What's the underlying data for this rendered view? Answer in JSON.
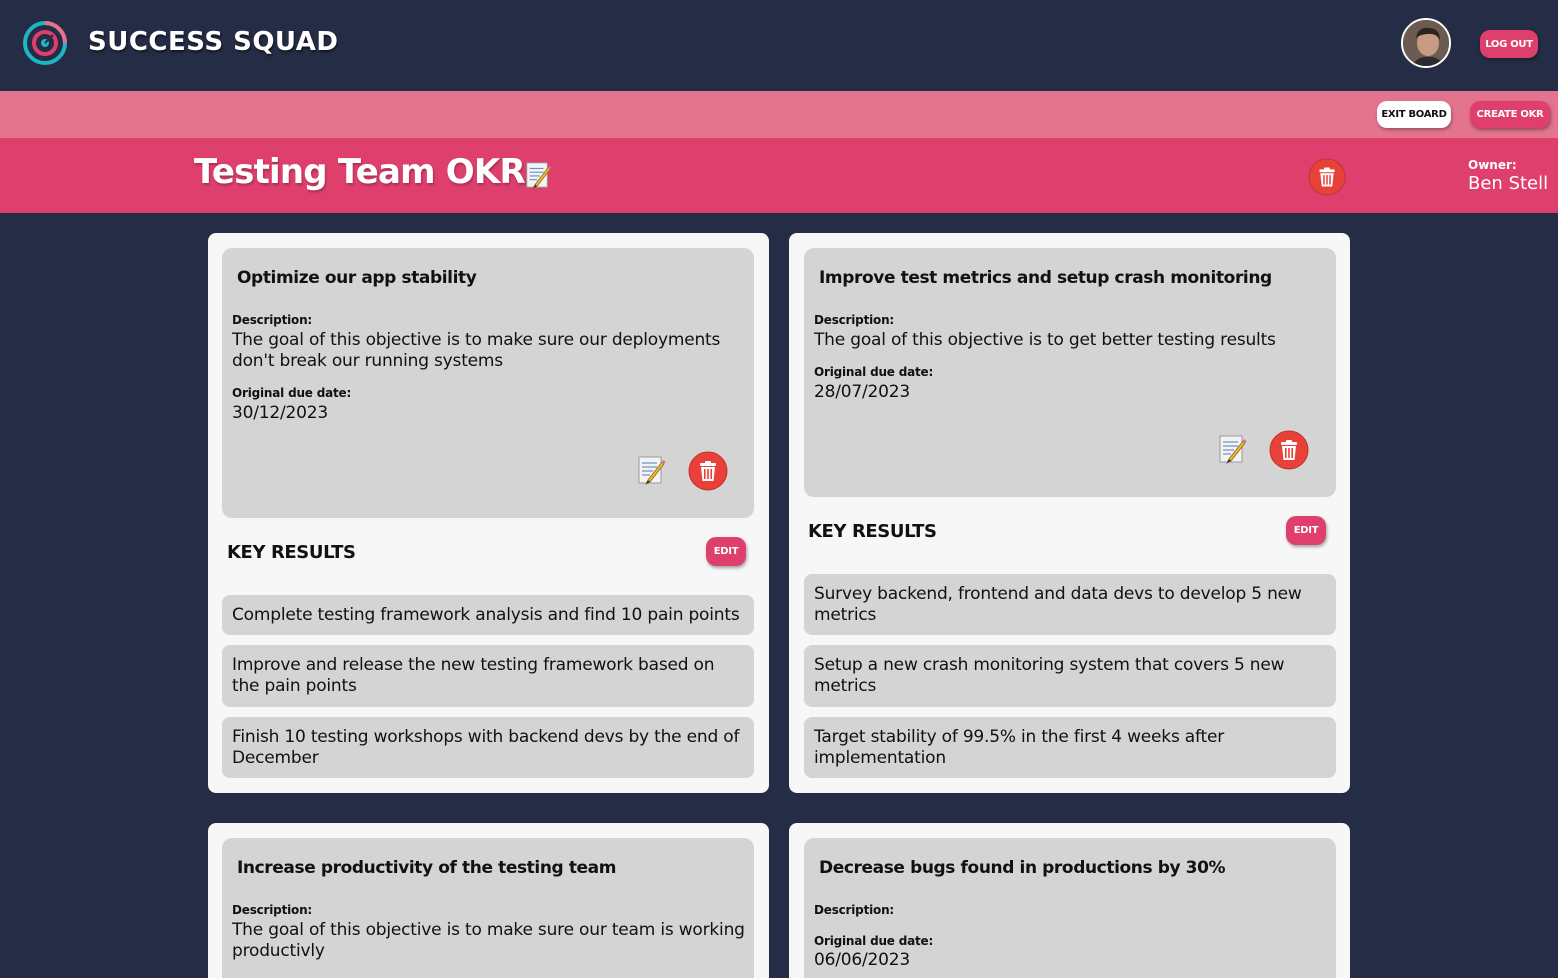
{
  "header": {
    "brand": "SUCCESS SQUAD",
    "logout_label": "LOG OUT"
  },
  "toolbar": {
    "exit_board_label": "EXIT BOARD",
    "create_okr_label": "CREATE OKR"
  },
  "board": {
    "title": "Testing Team OKRs",
    "owner_label": "Owner:",
    "owner_name": "Ben Stell"
  },
  "labels": {
    "description": "Description:",
    "due_date": "Original due date:",
    "key_results": "KEY RESULTS",
    "edit": "EDIT"
  },
  "okrs": [
    {
      "title": "Optimize our app stability",
      "description": "The goal of this objective is to make sure our deployments don't break our running systems",
      "due_date": "30/12/2023",
      "key_results": [
        "Complete testing framework analysis and find 10 pain points",
        "Improve and release the new testing framework based on the pain points",
        "Finish 10 testing workshops with backend devs by the end of December"
      ]
    },
    {
      "title": "Improve test metrics and setup crash monitoring",
      "description": "The goal of this objective is to get better testing results",
      "due_date": "28/07/2023",
      "key_results": [
        "Survey backend, frontend and data devs to develop 5 new metrics",
        "Setup a new crash monitoring system that covers 5 new metrics",
        "Target stability of 99.5% in the first 4 weeks after implementation"
      ]
    },
    {
      "title": "Increase productivity of the testing team",
      "description": "The goal of this objective is to make sure our team is working productivly"
    },
    {
      "title": "Decrease bugs found in productions by 30%",
      "description": "",
      "due_date": "06/06/2023"
    }
  ],
  "colors": {
    "background": "#252c45",
    "accent": "#de3f6d",
    "accent_light": "#e4738d",
    "card": "#f7f7f7",
    "panel": "#d4d4d4",
    "delete": "#e8413a"
  },
  "icons": [
    "logo-icon",
    "avatar",
    "edit-icon",
    "trash-icon"
  ]
}
